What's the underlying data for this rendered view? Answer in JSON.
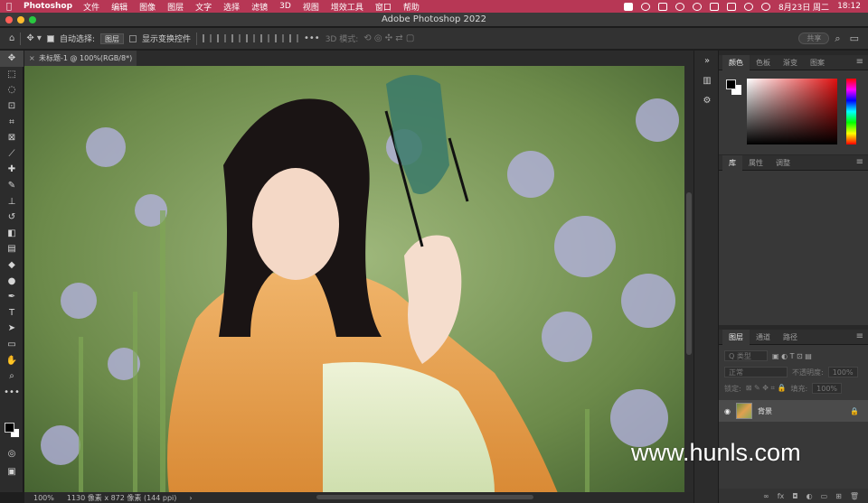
{
  "menubar": {
    "app_name": "Photoshop",
    "items": [
      "文件",
      "编辑",
      "图像",
      "图层",
      "文字",
      "选择",
      "滤镜",
      "3D",
      "视图",
      "增效工具",
      "窗口",
      "帮助"
    ],
    "date": "8月23日 周二",
    "time": "18:12",
    "bg_color": "#b73755"
  },
  "window": {
    "title": "Adobe Photoshop 2022"
  },
  "options": {
    "auto_select_label": "自动选择:",
    "auto_select_value": "图层",
    "show_transform_label": "显示变换控件",
    "mode_3d_label": "3D 模式:",
    "share_label": "共享"
  },
  "document": {
    "tab_title": "未标题-1 @ 100%(RGB/8*)",
    "zoom": "100%",
    "dimensions": "1130 像素 x 872 像素 (144 ppi)"
  },
  "panels": {
    "color_tabs": [
      "颜色",
      "色板",
      "渐变",
      "图案"
    ],
    "lib_tabs": [
      "库",
      "属性",
      "调整"
    ],
    "layer_tabs": [
      "图层",
      "通道",
      "路径"
    ],
    "kind_placeholder": "Q 类型",
    "blend_mode": "正常",
    "opacity_label": "不透明度:",
    "opacity_value": "100%",
    "lock_label": "锁定:",
    "fill_label": "填充:",
    "fill_value": "100%",
    "layer_name": "背景"
  },
  "watermark": "www.hunls.com"
}
